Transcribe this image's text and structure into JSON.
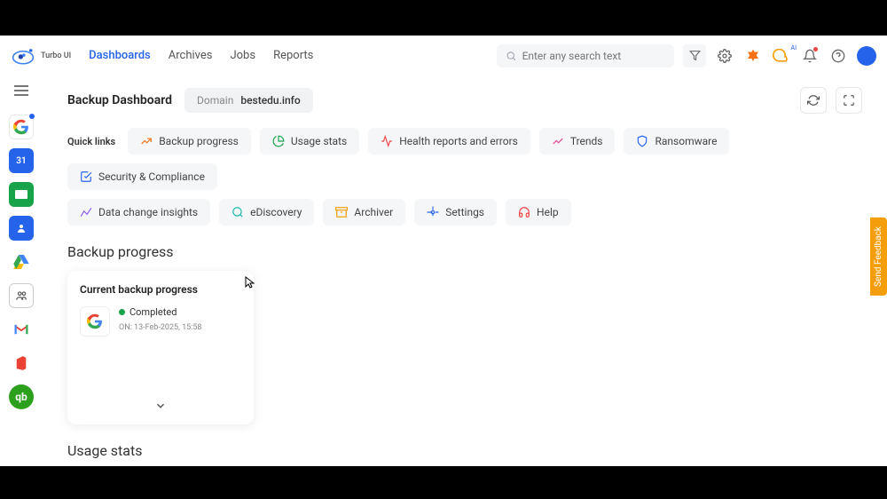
{
  "brand": "Turbo UI",
  "nav": {
    "dashboards": "Dashboards",
    "archives": "Archives",
    "jobs": "Jobs",
    "reports": "Reports"
  },
  "search": {
    "placeholder": "Enter any search text"
  },
  "ai_label": "AI",
  "page": {
    "title": "Backup Dashboard",
    "domain_label": "Domain",
    "domain_value": "bestedu.info"
  },
  "quick": {
    "label": "Quick links",
    "backup_progress": "Backup progress",
    "usage_stats": "Usage stats",
    "health": "Health reports and errors",
    "trends": "Trends",
    "ransomware": "Ransomware",
    "security": "Security & Compliance",
    "data_change": "Data change insights",
    "ediscovery": "eDiscovery",
    "archiver": "Archiver",
    "settings": "Settings",
    "help": "Help"
  },
  "section": {
    "backup_progress": "Backup progress",
    "usage_stats": "Usage stats"
  },
  "card": {
    "title": "Current backup progress",
    "status": "Completed",
    "on_label": "ON:",
    "on_value": "13-Feb-2025, 15:58"
  },
  "feedback": "Send Feedback",
  "colors": {
    "orange": "#f97316",
    "green": "#16a34a",
    "amber": "#f59e0b",
    "blue": "#2563eb",
    "red": "#ef4444",
    "teal": "#14b8a6",
    "purple": "#8b5cf6"
  }
}
